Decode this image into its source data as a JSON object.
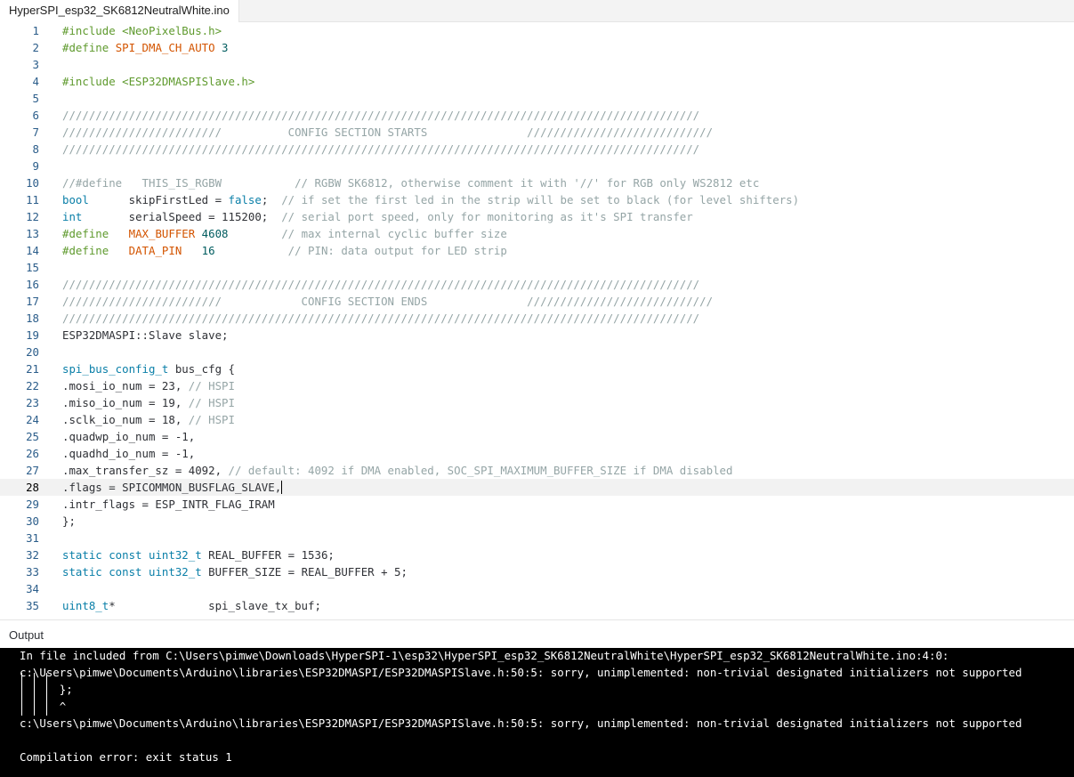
{
  "tab": {
    "title": "HyperSPI_esp32_SK6812NeutralWhite.ino"
  },
  "current_line": 28,
  "code_lines": [
    {
      "n": "1",
      "t": [
        [
          "pre",
          "#include <NeoPixelBus.h>"
        ]
      ]
    },
    {
      "n": "2",
      "t": [
        [
          "pre",
          "#define "
        ],
        [
          "macro",
          "SPI_DMA_CH_AUTO"
        ],
        [
          "num",
          " 3"
        ]
      ]
    },
    {
      "n": "3",
      "t": []
    },
    {
      "n": "4",
      "t": [
        [
          "pre",
          "#include <ESP32DMASPISlave.h>"
        ]
      ]
    },
    {
      "n": "5",
      "t": []
    },
    {
      "n": "6",
      "t": [
        [
          "cmt",
          "////////////////////////////////////////////////////////////////////////////////////////////////"
        ]
      ]
    },
    {
      "n": "7",
      "t": [
        [
          "cmt",
          "////////////////////////          CONFIG SECTION STARTS               ////////////////////////////"
        ]
      ]
    },
    {
      "n": "8",
      "t": [
        [
          "cmt",
          "////////////////////////////////////////////////////////////////////////////////////////////////"
        ]
      ]
    },
    {
      "n": "9",
      "t": []
    },
    {
      "n": "10",
      "t": [
        [
          "cmt",
          "//#define   THIS_IS_RGBW           // RGBW SK6812, otherwise comment it with '//' for RGB only WS2812 etc"
        ]
      ]
    },
    {
      "n": "11",
      "t": [
        [
          "type",
          "bool"
        ],
        [
          "plain",
          "      skipFirstLed = "
        ],
        [
          "kw",
          "false"
        ],
        [
          "plain",
          ";  "
        ],
        [
          "cmt",
          "// if set the first led in the strip will be set to black (for level shifters)"
        ]
      ]
    },
    {
      "n": "12",
      "t": [
        [
          "type",
          "int"
        ],
        [
          "plain",
          "       serialSpeed = 115200;  "
        ],
        [
          "cmt",
          "// serial port speed, only for monitoring as it's SPI transfer"
        ]
      ]
    },
    {
      "n": "13",
      "t": [
        [
          "pre",
          "#define   "
        ],
        [
          "macro",
          "MAX_BUFFER"
        ],
        [
          "num",
          " 4608"
        ],
        [
          "plain",
          "        "
        ],
        [
          "cmt",
          "// max internal cyclic buffer size"
        ]
      ]
    },
    {
      "n": "14",
      "t": [
        [
          "pre",
          "#define   "
        ],
        [
          "macro",
          "DATA_PIN"
        ],
        [
          "num",
          "   16"
        ],
        [
          "plain",
          "           "
        ],
        [
          "cmt",
          "// PIN: data output for LED strip"
        ]
      ]
    },
    {
      "n": "15",
      "t": []
    },
    {
      "n": "16",
      "t": [
        [
          "cmt",
          "////////////////////////////////////////////////////////////////////////////////////////////////"
        ]
      ]
    },
    {
      "n": "17",
      "t": [
        [
          "cmt",
          "////////////////////////            CONFIG SECTION ENDS               ////////////////////////////"
        ]
      ]
    },
    {
      "n": "18",
      "t": [
        [
          "cmt",
          "////////////////////////////////////////////////////////////////////////////////////////////////"
        ]
      ]
    },
    {
      "n": "19",
      "t": [
        [
          "plain",
          "ESP32DMASPI::Slave slave;"
        ]
      ]
    },
    {
      "n": "20",
      "t": []
    },
    {
      "n": "21",
      "t": [
        [
          "type",
          "spi_bus_config_t"
        ],
        [
          "plain",
          " bus_cfg {"
        ]
      ]
    },
    {
      "n": "22",
      "t": [
        [
          "plain",
          ".mosi_io_num = 23, "
        ],
        [
          "cmt",
          "// HSPI"
        ]
      ]
    },
    {
      "n": "23",
      "t": [
        [
          "plain",
          ".miso_io_num = 19, "
        ],
        [
          "cmt",
          "// HSPI"
        ]
      ]
    },
    {
      "n": "24",
      "t": [
        [
          "plain",
          ".sclk_io_num = 18, "
        ],
        [
          "cmt",
          "// HSPI"
        ]
      ]
    },
    {
      "n": "25",
      "t": [
        [
          "plain",
          ".quadwp_io_num = -1,"
        ]
      ]
    },
    {
      "n": "26",
      "t": [
        [
          "plain",
          ".quadhd_io_num = -1,"
        ]
      ]
    },
    {
      "n": "27",
      "t": [
        [
          "plain",
          ".max_transfer_sz = 4092, "
        ],
        [
          "cmt",
          "// default: 4092 if DMA enabled, SOC_SPI_MAXIMUM_BUFFER_SIZE if DMA disabled"
        ]
      ]
    },
    {
      "n": "28",
      "t": [
        [
          "plain",
          ".flags = SPICOMMON_BUSFLAG_SLAVE,"
        ]
      ]
    },
    {
      "n": "29",
      "t": [
        [
          "plain",
          ".intr_flags = ESP_INTR_FLAG_IRAM"
        ]
      ]
    },
    {
      "n": "30",
      "t": [
        [
          "plain",
          "};"
        ]
      ]
    },
    {
      "n": "31",
      "t": []
    },
    {
      "n": "32",
      "t": [
        [
          "kw",
          "static const "
        ],
        [
          "type",
          "uint32_t"
        ],
        [
          "plain",
          " REAL_BUFFER = 1536;"
        ]
      ]
    },
    {
      "n": "33",
      "t": [
        [
          "kw",
          "static const "
        ],
        [
          "type",
          "uint32_t"
        ],
        [
          "plain",
          " BUFFER_SIZE = REAL_BUFFER + 5;"
        ]
      ]
    },
    {
      "n": "34",
      "t": []
    },
    {
      "n": "35",
      "t": [
        [
          "type",
          "uint8_t"
        ],
        [
          "plain",
          "*              spi_slave_tx_buf;"
        ]
      ]
    }
  ],
  "colors": {
    "preprocessor": "#5f9a2e",
    "macro": "#d35400",
    "type": "#0a7fa8",
    "comment": "#95a5a6",
    "output_bg": "#000000"
  },
  "output": {
    "title": "Output",
    "lines": [
      "In file included from C:\\Users\\pimwe\\Downloads\\HyperSPI-1\\esp32\\HyperSPI_esp32_SK6812NeutralWhite\\HyperSPI_esp32_SK6812NeutralWhite.ino:4:0:",
      "c:\\Users\\pimwe\\Documents\\Arduino\\libraries\\ESP32DMASPI/ESP32DMASPISlave.h:50:5: sorry, unimplemented: non-trivial designated initializers not supported",
      "      };",
      "      ^",
      "c:\\Users\\pimwe\\Documents\\Arduino\\libraries\\ESP32DMASPI/ESP32DMASPISlave.h:50:5: sorry, unimplemented: non-trivial designated initializers not supported",
      "",
      "Compilation error: exit status 1"
    ]
  }
}
